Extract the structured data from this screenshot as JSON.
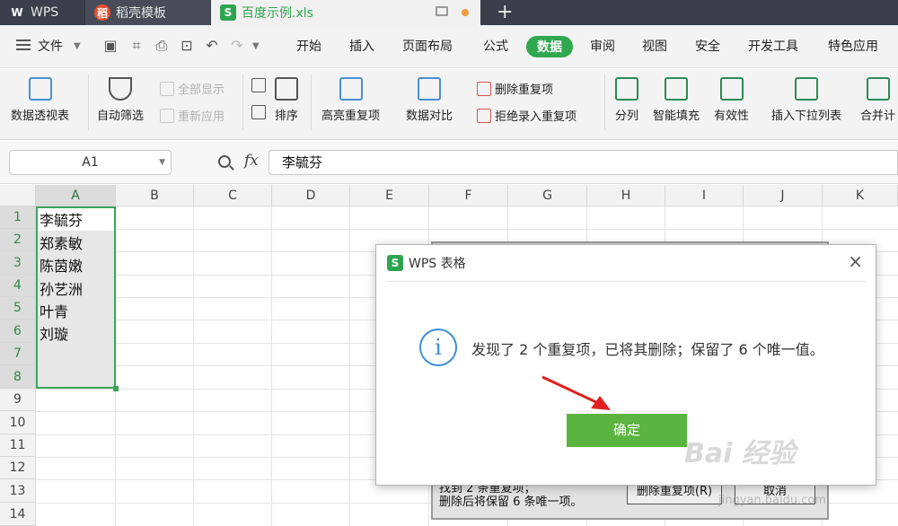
{
  "tabs": {
    "wps_label": "WPS",
    "daoke_label": "稻壳模板",
    "active_label": "百度示例.xls"
  },
  "menu": {
    "file": "文件",
    "items": [
      "开始",
      "插入",
      "页面布局",
      "公式",
      "数据",
      "审阅",
      "视图",
      "安全",
      "开发工具",
      "特色应用"
    ],
    "active": "数据"
  },
  "ribbon": {
    "pivot": "数据透视表",
    "autofilter": "自动筛选",
    "show_all": "全部显示",
    "reapply": "重新应用",
    "sort": "排序",
    "highlight_dup": "高亮重复项",
    "compare": "数据对比",
    "remove_dup": "删除重复项",
    "reject_dup": "拒绝录入重复项",
    "split": "分列",
    "smart_fill": "智能填充",
    "validity": "有效性",
    "insert_dropdown": "插入下拉列表",
    "merge": "合并计"
  },
  "formula": {
    "namebox": "A1",
    "fx": "fx",
    "value": "李毓芬"
  },
  "sheet": {
    "columns": [
      "A",
      "B",
      "C",
      "D",
      "E",
      "F",
      "G",
      "H",
      "I",
      "J",
      "K"
    ],
    "rows": [
      "1",
      "2",
      "3",
      "4",
      "5",
      "6",
      "7",
      "8",
      "9",
      "10",
      "11",
      "12",
      "13",
      "14"
    ],
    "cells_A": [
      "李毓芬",
      "郑素敏",
      "陈茵嫩",
      "孙艺洲",
      "叶青",
      "刘璇"
    ]
  },
  "bg_dialog": {
    "line1": "找到 2 条重复项；",
    "line2": "删除后将保留 6 条唯一项。",
    "delete_btn": "删除重复项(R)",
    "cancel_btn": "取消"
  },
  "dialog": {
    "title": "WPS 表格",
    "message": "发现了 2 个重复项，已将其删除；保留了 6 个唯一值。",
    "ok": "确定",
    "close": "×"
  },
  "watermark": {
    "brand": "Bai 经验",
    "url": "jingyan.baidu.com"
  },
  "colors": {
    "accent_green": "#2ea44f",
    "ok_green": "#5bb440",
    "info_blue": "#3d8fd6",
    "arrow_red": "#e02020"
  }
}
